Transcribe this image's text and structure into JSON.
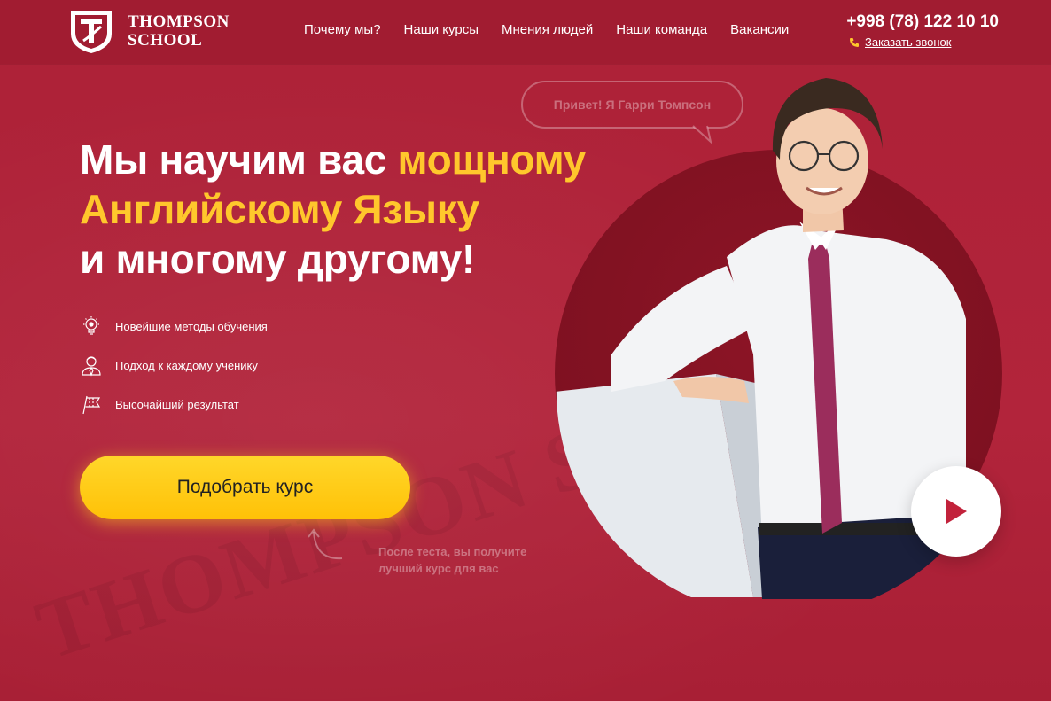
{
  "brand": {
    "line1": "THOMPSON",
    "line2": "SCHOOL"
  },
  "nav": {
    "items": [
      {
        "label": "Почему мы?"
      },
      {
        "label": "Наши курсы"
      },
      {
        "label": "Мнения людей"
      },
      {
        "label": "Наши команда"
      },
      {
        "label": "Вакансии"
      }
    ]
  },
  "contact": {
    "phone": "+998 (78) 122 10 10",
    "callback_label": "Заказать звонок"
  },
  "hero": {
    "headline_part1": "Мы научим вас ",
    "headline_accent1": "мощному",
    "headline_accent2": "Английскому Языку",
    "headline_part2": "и многому другому!",
    "features": [
      {
        "icon": "lightbulb-icon",
        "text": "Новейшие методы обучения"
      },
      {
        "icon": "person-icon",
        "text": "Подход к каждому ученику"
      },
      {
        "icon": "flag-icon",
        "text": "Высочайший результат"
      }
    ],
    "cta_label": "Подобрать курс",
    "note_line1": "После теста, вы получите",
    "note_line2": "лучший курс для вас",
    "speech_text": "Привет! Я Гарри Томпсон"
  },
  "colors": {
    "background": "#b0223a",
    "header": "#a11c31",
    "accent": "#ffc72c",
    "play": "#c2223b"
  }
}
